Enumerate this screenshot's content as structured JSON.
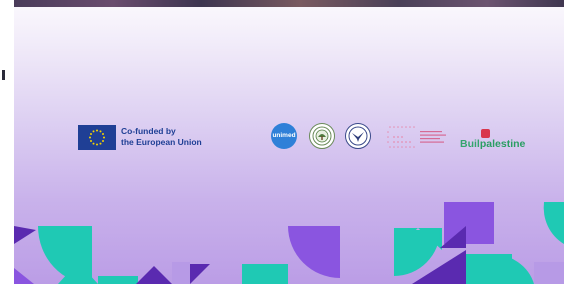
{
  "eu_logo": {
    "line1": "Co-funded by",
    "line2": "the European Union",
    "flag_color": "#1f3f95",
    "star_color": "#f5d400"
  },
  "partners": {
    "unimed_label": "unimed",
    "build_palestine_prefix": "Buil",
    "build_palestine_rest": "palestine"
  },
  "palette": {
    "teal": "#1fc9b4",
    "purple": "#8a55e0",
    "deep_purple": "#5a2ab0",
    "lilac": "#b79ae6"
  }
}
